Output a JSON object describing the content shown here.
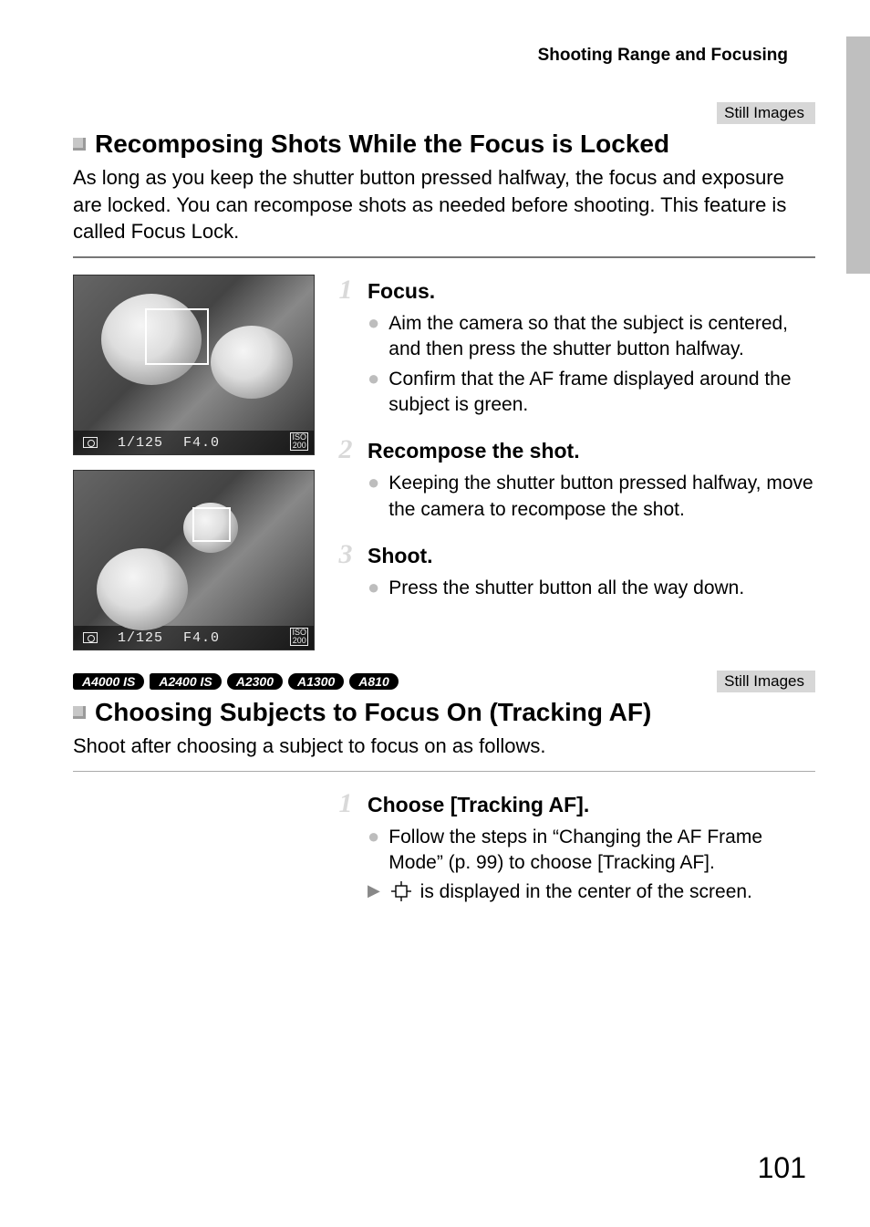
{
  "breadcrumb": "Shooting Range and Focusing",
  "tag_still_images": "Still Images",
  "page_number": "101",
  "section1": {
    "heading": "Recomposing Shots While the Focus is Locked",
    "intro": "As long as you keep the shutter button pressed halfway, the focus and exposure are locked. You can recompose shots as needed before shooting. This feature is called Focus Lock.",
    "thumb1": {
      "shutter": "1/125",
      "aperture": "F4.0",
      "iso_label_top": "ISO",
      "iso_label_bottom": "200"
    },
    "thumb2": {
      "shutter": "1/125",
      "aperture": "F4.0",
      "iso_label_top": "ISO",
      "iso_label_bottom": "200"
    },
    "steps": [
      {
        "num": "1",
        "title": "Focus.",
        "bullets": [
          "Aim the camera so that the subject is centered, and then press the shutter button halfway.",
          "Confirm that the AF frame displayed around the subject is green."
        ]
      },
      {
        "num": "2",
        "title": "Recompose the shot.",
        "bullets": [
          "Keeping the shutter button pressed halfway, move the camera to recompose the shot."
        ]
      },
      {
        "num": "3",
        "title": "Shoot.",
        "bullets": [
          "Press the shutter button all the way down."
        ]
      }
    ]
  },
  "models": [
    "A4000 IS",
    "A2400 IS",
    "A2300",
    "A1300",
    "A810"
  ],
  "section2": {
    "heading": "Choosing Subjects to Focus On (Tracking AF)",
    "intro": "Shoot after choosing a subject to focus on as follows.",
    "steps": [
      {
        "num": "1",
        "title": "Choose [Tracking AF].",
        "bullet": "Follow the steps in “Changing the AF Frame Mode” (p. 99) to choose [Tracking AF].",
        "result_after_icon": " is displayed in the center of the screen."
      }
    ]
  }
}
